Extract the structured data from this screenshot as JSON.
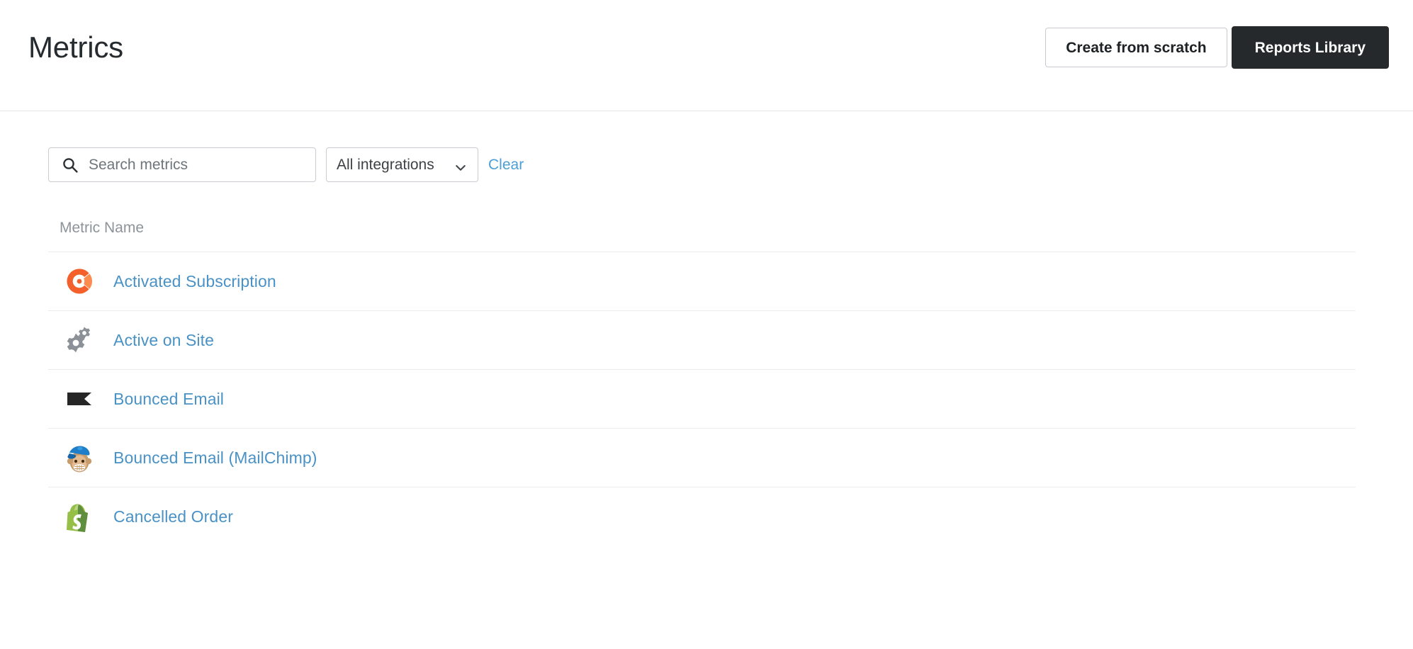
{
  "header": {
    "title": "Metrics",
    "create_button_label": "Create from scratch",
    "reports_button_label": "Reports Library"
  },
  "filters": {
    "search": {
      "placeholder": "Search metrics",
      "value": "",
      "icon": "search-icon"
    },
    "integration_select": {
      "selected": "All integrations",
      "options": [
        "All integrations"
      ],
      "icon": "chevron-down-icon"
    },
    "clear_label": "Clear"
  },
  "table": {
    "columns": [
      "Metric Name"
    ],
    "rows": [
      {
        "name": "Activated Subscription",
        "icon": "chargify-c-icon"
      },
      {
        "name": "Active on Site",
        "icon": "gears-icon"
      },
      {
        "name": "Bounced Email",
        "icon": "klaviyo-flag-icon"
      },
      {
        "name": "Bounced Email (MailChimp)",
        "icon": "mailchimp-monkey-icon"
      },
      {
        "name": "Cancelled Order",
        "icon": "shopify-bag-icon"
      }
    ]
  },
  "colors": {
    "link": "#4a92c5",
    "primary_button_bg": "#26292b",
    "muted_text": "#8d9499",
    "chargify_orange": "#f4602c",
    "gear_gray": "#8b9196",
    "klaviyo_black": "#262626",
    "shopify_green": "#8bc53f",
    "mailchimp_blue": "#1e7ec8"
  }
}
